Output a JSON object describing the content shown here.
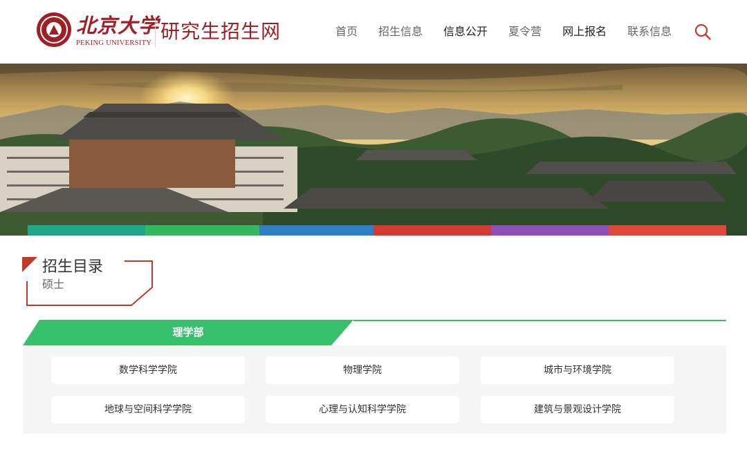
{
  "header": {
    "logo_cn": "北京大学",
    "logo_en": "PEKING UNIVERSITY",
    "site_title": "研究生招生网",
    "nav": [
      "首页",
      "招生信息",
      "信息公开",
      "夏令营",
      "网上报名",
      "联系信息"
    ],
    "nav_emphasis": [
      false,
      false,
      true,
      false,
      true,
      false
    ],
    "search_icon": "search-icon"
  },
  "banner": {
    "image": "campus-sunset-photo",
    "stripe_colors": [
      "#1fa68a",
      "#34b85f",
      "#2e7fc6",
      "#d23a34",
      "#8e4fb6",
      "#e0473d"
    ]
  },
  "section": {
    "title": "招生目录",
    "subtitle": "硕士"
  },
  "department": {
    "name": "理学部",
    "schools": [
      "数学科学学院",
      "物理学院",
      "城市与环境学院",
      "地球与空间科学学院",
      "心理与认知科学学院",
      "建筑与景观设计学院"
    ]
  },
  "colors": {
    "brand": "#9e1f24",
    "accent_green": "#36c06a",
    "search": "#c0392b"
  }
}
